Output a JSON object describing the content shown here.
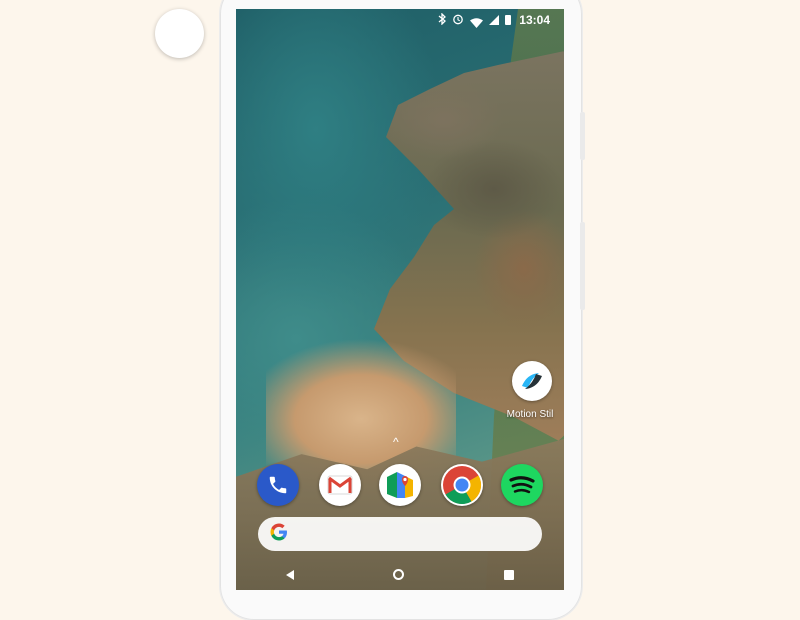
{
  "status_bar": {
    "time": "13:04",
    "icons": [
      "bluetooth-icon",
      "alarm-icon",
      "wifi-icon",
      "signal-icon",
      "battery-icon"
    ]
  },
  "home_screen": {
    "shortcuts": [
      {
        "label": "Motion Stil",
        "icon": "motion-stills-icon"
      }
    ],
    "dock": [
      {
        "name": "Phone",
        "icon": "phone-icon"
      },
      {
        "name": "Gmail",
        "icon": "gmail-icon"
      },
      {
        "name": "Maps",
        "icon": "maps-icon"
      },
      {
        "name": "Chrome",
        "icon": "chrome-icon"
      },
      {
        "name": "Spotify",
        "icon": "spotify-icon"
      }
    ],
    "app_drawer_hint": "^",
    "search": {
      "logo": "G",
      "placeholder": ""
    }
  },
  "nav_bar": {
    "buttons": [
      "back",
      "home",
      "recents"
    ]
  },
  "colors": {
    "phone_app": "#2a59c9",
    "spotify_app": "#1ed760",
    "chrome_red": "#db4437",
    "chrome_yellow": "#f4b400",
    "chrome_green": "#0f9d58",
    "chrome_blue": "#4285f4"
  }
}
